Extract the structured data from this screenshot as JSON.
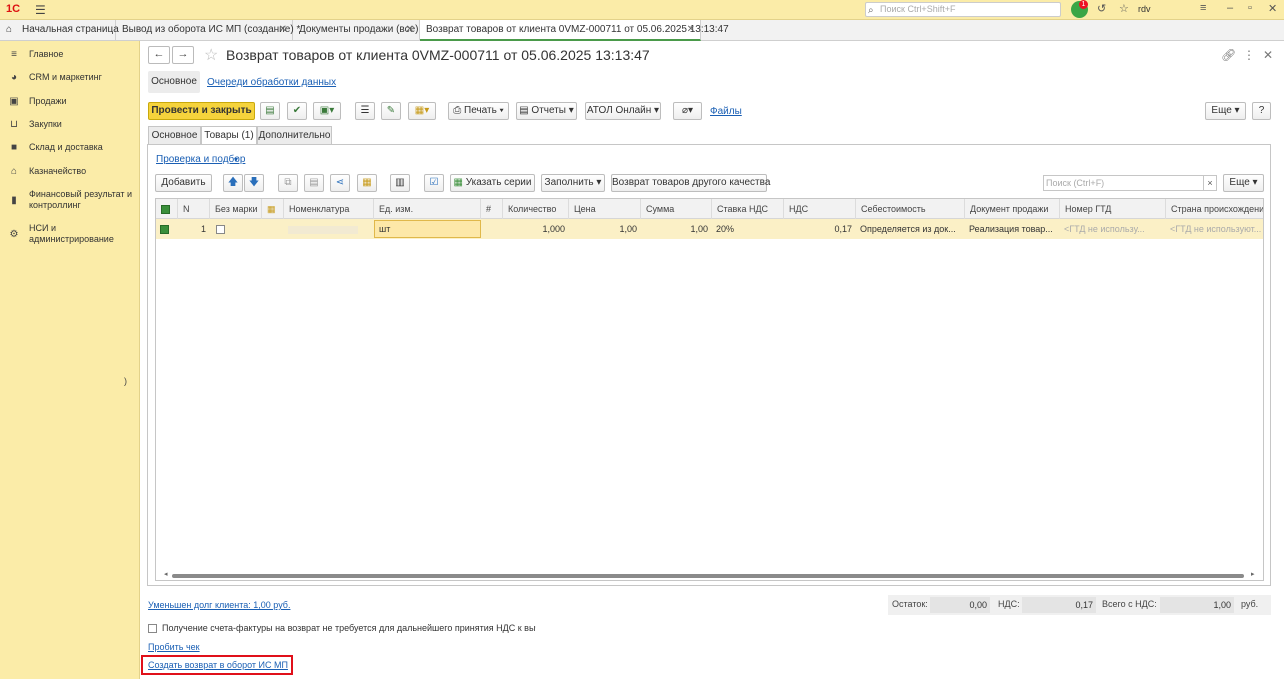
{
  "app": {
    "logo": "1С",
    "search_placeholder": "Поиск Ctrl+Shift+F",
    "notifications_count": "1",
    "user": "rdv"
  },
  "open_tabs": [
    {
      "label": "Начальная страница"
    },
    {
      "label": "Вывод из оборота ИС МП (создание) *"
    },
    {
      "label": "Документы продажи (все)"
    },
    {
      "label": "Возврат товаров от клиента 0VMZ-000711 от 05.06.2025 13:13:47"
    }
  ],
  "sidebar": {
    "items": [
      {
        "label": "Главное",
        "icon": "menu-icon"
      },
      {
        "label": "CRM и маркетинг",
        "icon": "pie-icon"
      },
      {
        "label": "Продажи",
        "icon": "bag-icon"
      },
      {
        "label": "Закупки",
        "icon": "cart-icon"
      },
      {
        "label": "Склад и доставка",
        "icon": "box-icon"
      },
      {
        "label": "Казначейство",
        "icon": "bank-icon"
      },
      {
        "label": "Финансовый результат и контроллинг",
        "icon": "bar-chart-icon"
      },
      {
        "label": "НСИ и администрирование",
        "icon": "gear-icon"
      }
    ],
    "stray_char": ")"
  },
  "document": {
    "title": "Возврат товаров от клиента 0VMZ-000711 от 05.06.2025 13:13:47",
    "subnav": {
      "main": "Основное",
      "queue": "Очереди обработки данных"
    }
  },
  "commands": {
    "post_close": "Провести и закрыть",
    "print": "Печать",
    "reports": "Отчеты",
    "atol": "АТОЛ Онлайн",
    "files": "Файлы",
    "more": "Еще",
    "help": "?"
  },
  "form_tabs": {
    "main": "Основное",
    "goods": "Товары (1)",
    "extra": "Дополнительно"
  },
  "goods": {
    "pick_link": "Проверка и подбор",
    "add": "Добавить",
    "set_series": "Указать серии",
    "fill": "Заполнить",
    "return_other": "Возврат товаров другого качества",
    "search_placeholder": "Поиск (Ctrl+F)",
    "more": "Еще",
    "columns": [
      "N",
      "Без марки",
      "Номенклатура",
      "Ед. изм.",
      "Количество",
      "Цена",
      "Сумма",
      "Ставка НДС",
      "НДС",
      "Себестоимость",
      "Документ продажи",
      "Номер ГТД",
      "Страна происхождения"
    ],
    "rows": [
      {
        "n": "1",
        "unit": "шт",
        "qty": "1,000",
        "price": "1,00",
        "sum": "1,00",
        "vat_rate": "20%",
        "vat": "0,17",
        "cost": "Определяется из док...",
        "sale_doc": "Реализация товар...",
        "gtd": "<ГТД не использу...",
        "country": "<ГТД не используют..."
      }
    ]
  },
  "footer": {
    "debt_link": "Уменьшен долг клиента: 1,00 руб.",
    "remainder_label": "Остаток:",
    "remainder": "0,00",
    "vat_label": "НДС:",
    "vat": "0,17",
    "total_label": "Всего с НДС:",
    "total": "1,00",
    "currency": "руб.",
    "invoice_checkbox": "Получение счета-фактуры на возврат не требуется для дальнейшего принятия НДС к вычету",
    "punch_receipt": "Пробить чек",
    "create_return": "Создать возврат в оборот ИС МП"
  }
}
